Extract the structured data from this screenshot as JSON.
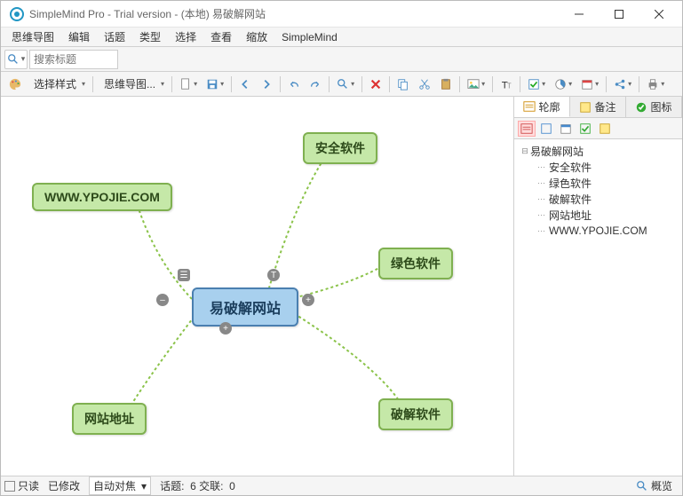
{
  "titlebar": {
    "title": "SimpleMind Pro - Trial version - (本地) 易破解网站"
  },
  "menubar": {
    "items": [
      "思维导图",
      "编辑",
      "话题",
      "类型",
      "选择",
      "查看",
      "缩放",
      "SimpleMind"
    ]
  },
  "searchbar": {
    "placeholder": "搜索标题"
  },
  "toolbar": {
    "style_label": "选择样式",
    "mindmap_label": "思维导图..."
  },
  "mindmap": {
    "center": "易破解网站",
    "nodes": {
      "n1": "WWW.YPOJIE.COM",
      "n2": "安全软件",
      "n3": "绿色软件",
      "n4": "破解软件",
      "n5": "网站地址"
    }
  },
  "right_panel": {
    "tabs": {
      "outline": "轮廓",
      "notes": "备注",
      "icons": "图标"
    },
    "tree": {
      "root": "易破解网站",
      "children": [
        "安全软件",
        "绿色软件",
        "破解软件",
        "网站地址",
        "WWW.YPOJIE.COM"
      ]
    }
  },
  "statusbar": {
    "readonly": "只读",
    "modified": "已修改",
    "autofocus": "自动对焦",
    "topics_label": "话题:",
    "topics_count": "6",
    "cross_label": "交联:",
    "cross_count": "0",
    "preview": "概览"
  }
}
